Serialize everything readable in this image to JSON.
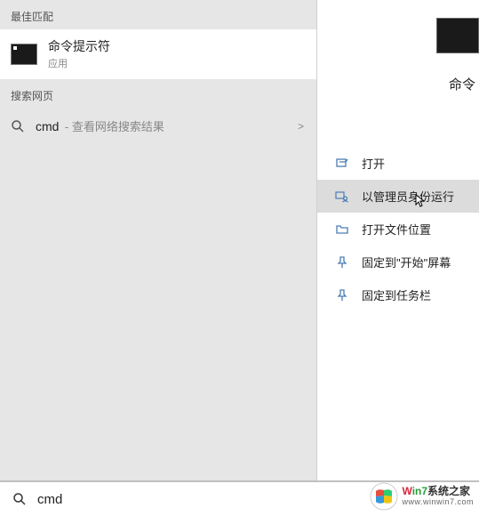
{
  "left": {
    "best_match_header": "最佳匹配",
    "best_match": {
      "title": "命令提示符",
      "subtitle": "应用"
    },
    "web_header": "搜索网页",
    "web_row": {
      "term": "cmd",
      "hint": "- 查看网络搜索结果",
      "chevron": ">"
    }
  },
  "right": {
    "app_title_partial": "命令",
    "actions": [
      {
        "label": "打开",
        "icon": "open-icon"
      },
      {
        "label": "以管理员身份运行",
        "icon": "admin-icon",
        "highlighted": true
      },
      {
        "label": "打开文件位置",
        "icon": "folder-icon"
      },
      {
        "label": "固定到\"开始\"屏幕",
        "icon": "pin-start-icon"
      },
      {
        "label": "固定到任务栏",
        "icon": "pin-taskbar-icon"
      }
    ]
  },
  "search_bar": {
    "value": "cmd"
  },
  "watermark": {
    "line1_w": "W",
    "line1_in7": "in7",
    "line1_rest": "系统之家",
    "line2": "www.winwin7.com"
  }
}
